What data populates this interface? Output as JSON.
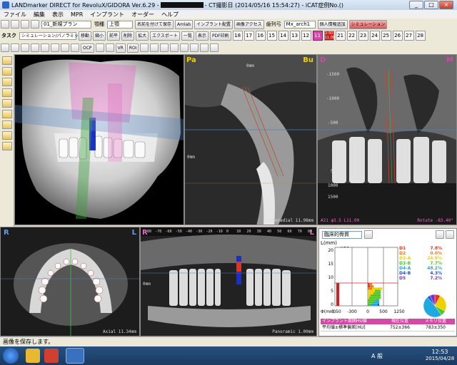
{
  "window": {
    "title_prefix": "LANDmarker DIRECT for RevoluX/GIDORA Ver.6.29 -",
    "title_suffix": "- CT撮影日 (2014/05/16 15:54:27) - iCAT症例No.()",
    "controls": [
      "_",
      "□",
      "×"
    ]
  },
  "menu": [
    "ファイル",
    "編集",
    "表示",
    "MPR",
    "インプラント",
    "オーダー",
    "ヘルプ"
  ],
  "toolbar1": {
    "plan_select": "01_新規プラン",
    "jaw_label": "顎種",
    "jaw_select": "上顎",
    "arch_label": "歯列弓",
    "arch_select": "Mx_arch1",
    "buttons": [
      "名前を付けて保存",
      "Amlab",
      "インプラント配置",
      "画像アクセス",
      "個人情報追加"
    ],
    "top_right_btn": "シミュレーション"
  },
  "toolbar2": {
    "task_label": "タスク",
    "task_select": "シミュレーション/パノラミックMPR",
    "buttons": [
      "移動",
      "縮小",
      "前平",
      "削除",
      "拡大",
      "エクスポート",
      "一覧",
      "表示",
      "PDF印刷"
    ],
    "teeth": [
      "18",
      "17",
      "16",
      "15",
      "14",
      "13",
      "12",
      "11",
      "21",
      "22",
      "23",
      "24",
      "25",
      "26",
      "27",
      "28"
    ],
    "active_tooth": "11",
    "date_badge": "2-50 11.00",
    "extra_tooth": "12"
  },
  "toolbar3": {
    "buttons": [
      "VR",
      "ROI",
      "OCP"
    ]
  },
  "views": {
    "v3d": {},
    "pa": {
      "label": "Pa",
      "label_right": "Bu",
      "footer": "Orthoradial 11.98mm",
      "scale_top": "0mm",
      "scale_side": "0mm"
    },
    "d": {
      "label": "D",
      "label_right": "M",
      "y_ticks": [
        "-1500",
        "-1000",
        "-500",
        "0",
        "500",
        "1000",
        "1500"
      ],
      "footer_left": "#21 φ3.5 L11.00",
      "footer_right": "Rotate -83.40°"
    },
    "axial": {
      "label_left": "R",
      "label_right": "L",
      "footer": "Axial 11.34mm"
    },
    "pano": {
      "label_left": "R",
      "label_right": "L",
      "x_ticks": [
        "-80",
        "-70",
        "-60",
        "-50",
        "-40",
        "-30",
        "-20",
        "-10",
        "0",
        "10",
        "20",
        "30",
        "40",
        "50",
        "60",
        "70",
        "80"
      ],
      "footer": "Panoramic 1.00mm",
      "scale_side": "0mm"
    }
  },
  "chartpanel": {
    "header_select": "臨床的骨質",
    "tooth_id": "#21",
    "y_axis_label": "L(mm)",
    "y_ticks": [
      "20",
      "15",
      "10",
      "5",
      "0"
    ],
    "x_label": "Φ(mm)",
    "x_ticks": [
      "3.50",
      "-300",
      "0",
      "500",
      "1250"
    ],
    "legend": [
      {
        "label": "D1",
        "value": "7.8%",
        "color": "#e83020"
      },
      {
        "label": "D2",
        "value": "0.0%",
        "color": "#f07818"
      },
      {
        "label": "D3-A",
        "value": "24.8%",
        "color": "#f0d000"
      },
      {
        "label": "D3-B",
        "value": "7.7%",
        "color": "#50c820"
      },
      {
        "label": "D4-A",
        "value": "48.2%",
        "color": "#20a8e0"
      },
      {
        "label": "D4-B",
        "value": "4.3%",
        "color": "#2050d0"
      },
      {
        "label": "D5",
        "value": "7.2%",
        "color": "#8030c0"
      }
    ],
    "table": {
      "headers": [
        "インプラント周囲HU値",
        "現在位置",
        "メモリ位置"
      ],
      "row_label": "平均値±標準偏差[HU]",
      "current": "752±366",
      "memory": "783±350"
    }
  },
  "status": "画像を保存します。",
  "taskbar": {
    "time": "12:53",
    "date": "2015/04/28",
    "ime": "A 般"
  }
}
